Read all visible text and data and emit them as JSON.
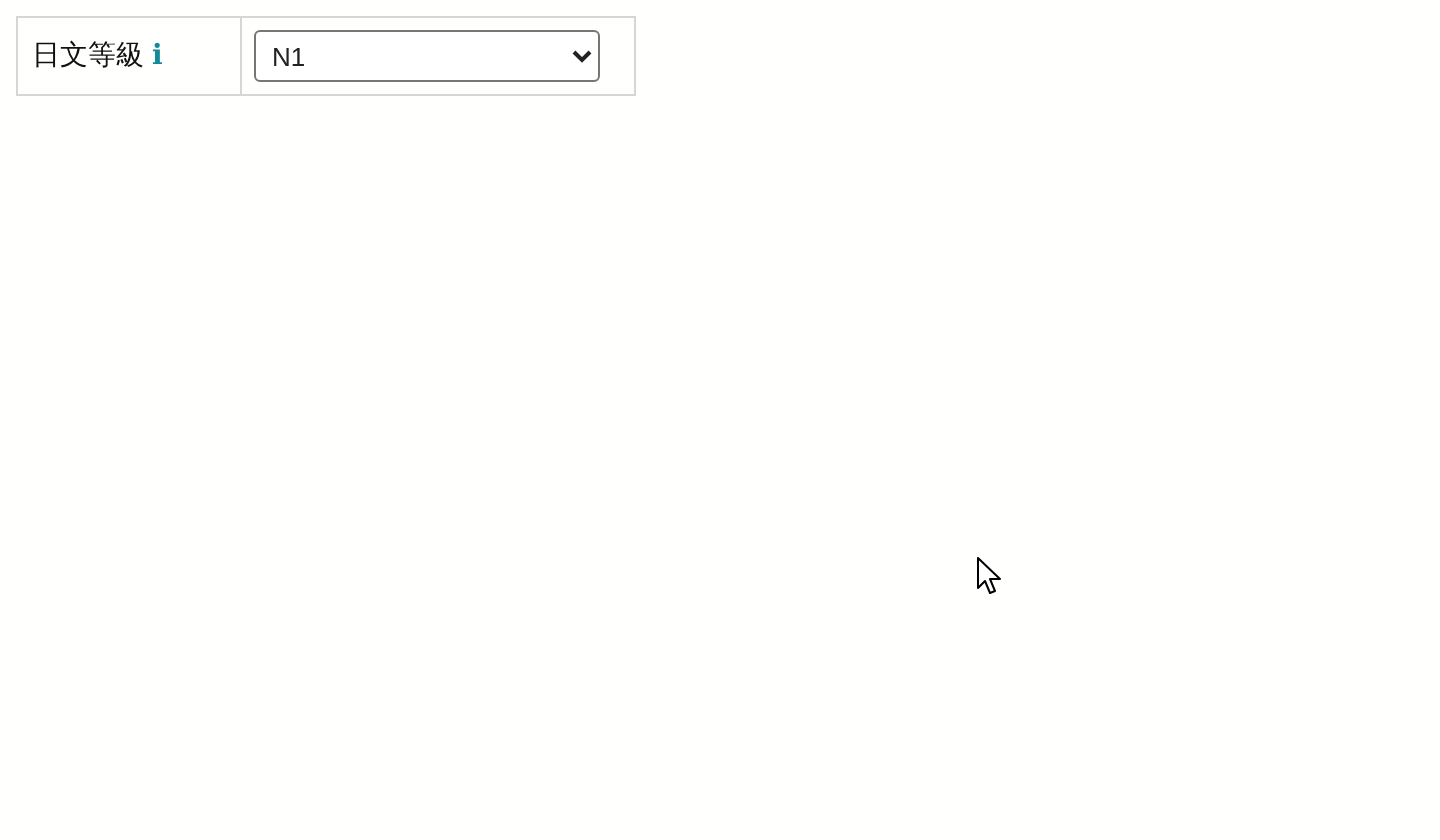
{
  "form": {
    "rows": [
      {
        "label": "日文等級",
        "info": "i",
        "value": "N1"
      }
    ]
  }
}
